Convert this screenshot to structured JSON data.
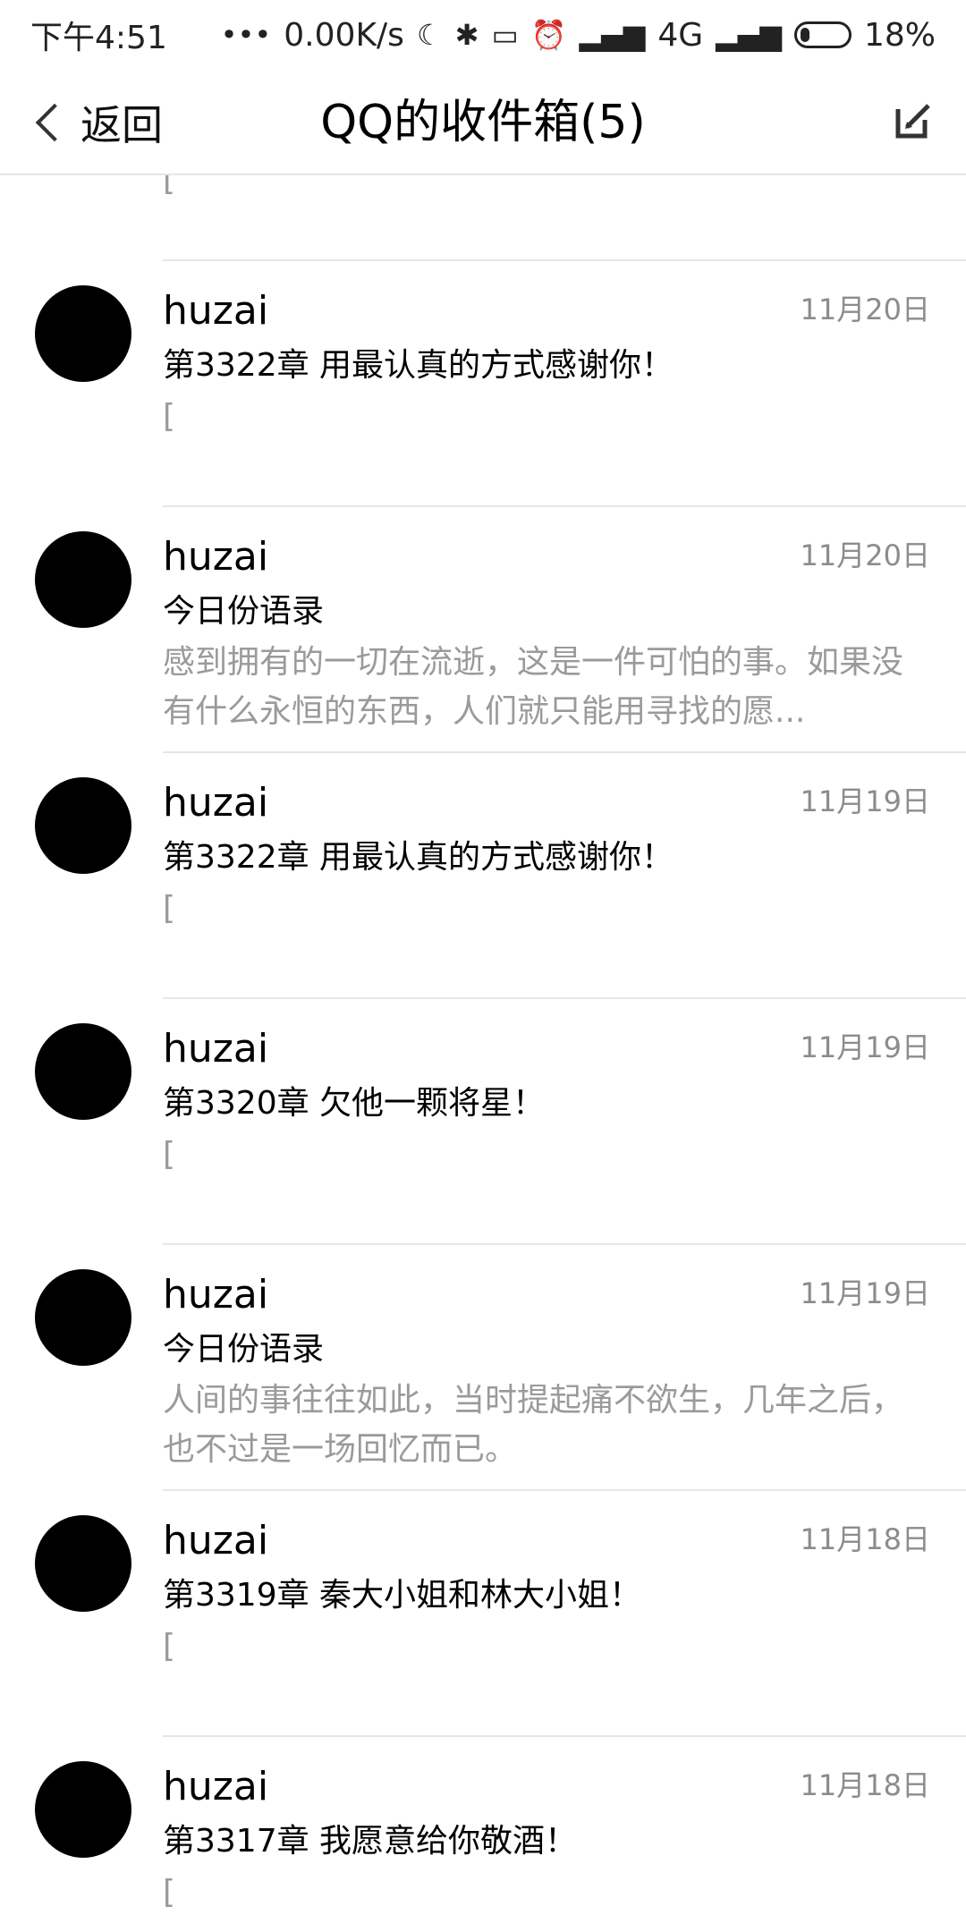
{
  "status_bar": {
    "time": "下午4:51",
    "dots": "•••",
    "speed": "0.00K/s",
    "network": "4G",
    "battery": "18%"
  },
  "nav": {
    "back_label": "返回",
    "title": "QQ的收件箱(5)"
  },
  "partial_top": {
    "preview": "["
  },
  "messages": [
    {
      "sender": "huzai",
      "date": "11月20日",
      "subject": "第3322章 用最认真的方式感谢你！",
      "preview": "["
    },
    {
      "sender": "huzai",
      "date": "11月20日",
      "subject": "今日份语录",
      "preview": "感到拥有的一切在流逝，这是一件可怕的事。如果没有什么永恒的东西，人们就只能用寻找的愿..."
    },
    {
      "sender": "huzai",
      "date": "11月19日",
      "subject": "第3322章 用最认真的方式感谢你！",
      "preview": "["
    },
    {
      "sender": "huzai",
      "date": "11月19日",
      "subject": "第3320章 欠他一颗将星！",
      "preview": "["
    },
    {
      "sender": "huzai",
      "date": "11月19日",
      "subject": "今日份语录",
      "preview": "人间的事往往如此，当时提起痛不欲生，几年之后，也不过是一场回忆而已。"
    },
    {
      "sender": "huzai",
      "date": "11月18日",
      "subject": "第3319章 秦大小姐和林大小姐！",
      "preview": "["
    },
    {
      "sender": "huzai",
      "date": "11月18日",
      "subject": "第3317章 我愿意给你敬酒！",
      "preview": "["
    }
  ]
}
